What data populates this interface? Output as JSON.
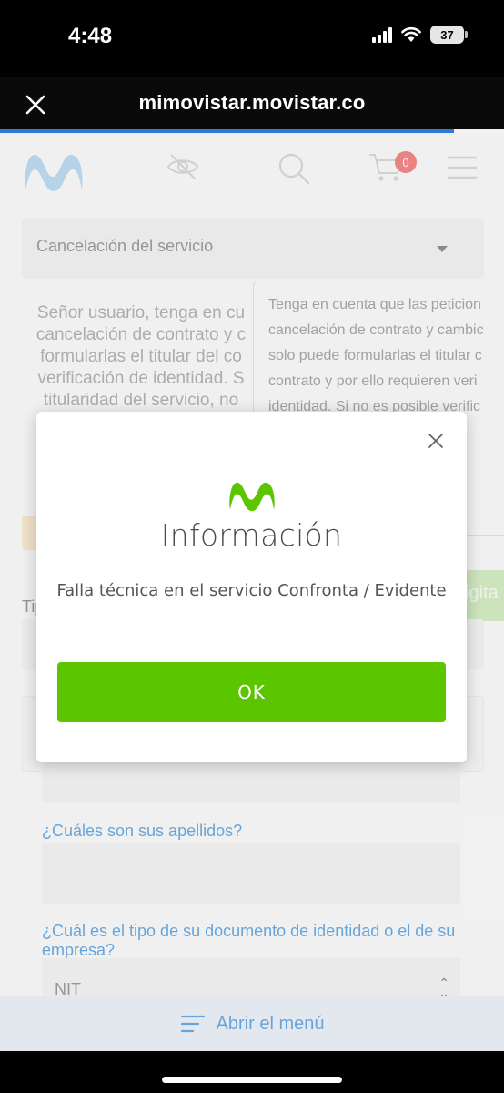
{
  "status_bar": {
    "time": "4:48",
    "battery": "37"
  },
  "browser": {
    "url": "mimovistar.movistar.co",
    "progress": 0.9
  },
  "header": {
    "cart_count": "0"
  },
  "background": {
    "request_type": "Cancelación del servicio",
    "notice": "Señor usuario, tenga en cu cancelación de contrato y c formularlas el titular del co verificación de identidad. S titularidad del servicio, no",
    "tooltip": "Tenga en cuenta que las peticion cancelación de contrato y cambic solo puede formularlas el titular c contrato y por ello requieren veri identidad. Si no es posible verific erá pon e soli de au mpo",
    "tip_label": "Tip",
    "green_button": "igita",
    "labels": {
      "surnames": "¿Cuáles son sus apellidos?",
      "doc_type": "¿Cuál es el tipo de su documento de identidad o el de su empresa?"
    },
    "doc_type_value": "NIT"
  },
  "bottom_menu": {
    "label": "Abrir el menú"
  },
  "modal": {
    "title": "Información",
    "message": "Falla técnica en el servicio Confronta / Evidente",
    "ok_label": "OK"
  },
  "colors": {
    "brand_green": "#5bc500",
    "link_blue": "#2f8fe0",
    "logo_blue": "#a8d4f2"
  }
}
